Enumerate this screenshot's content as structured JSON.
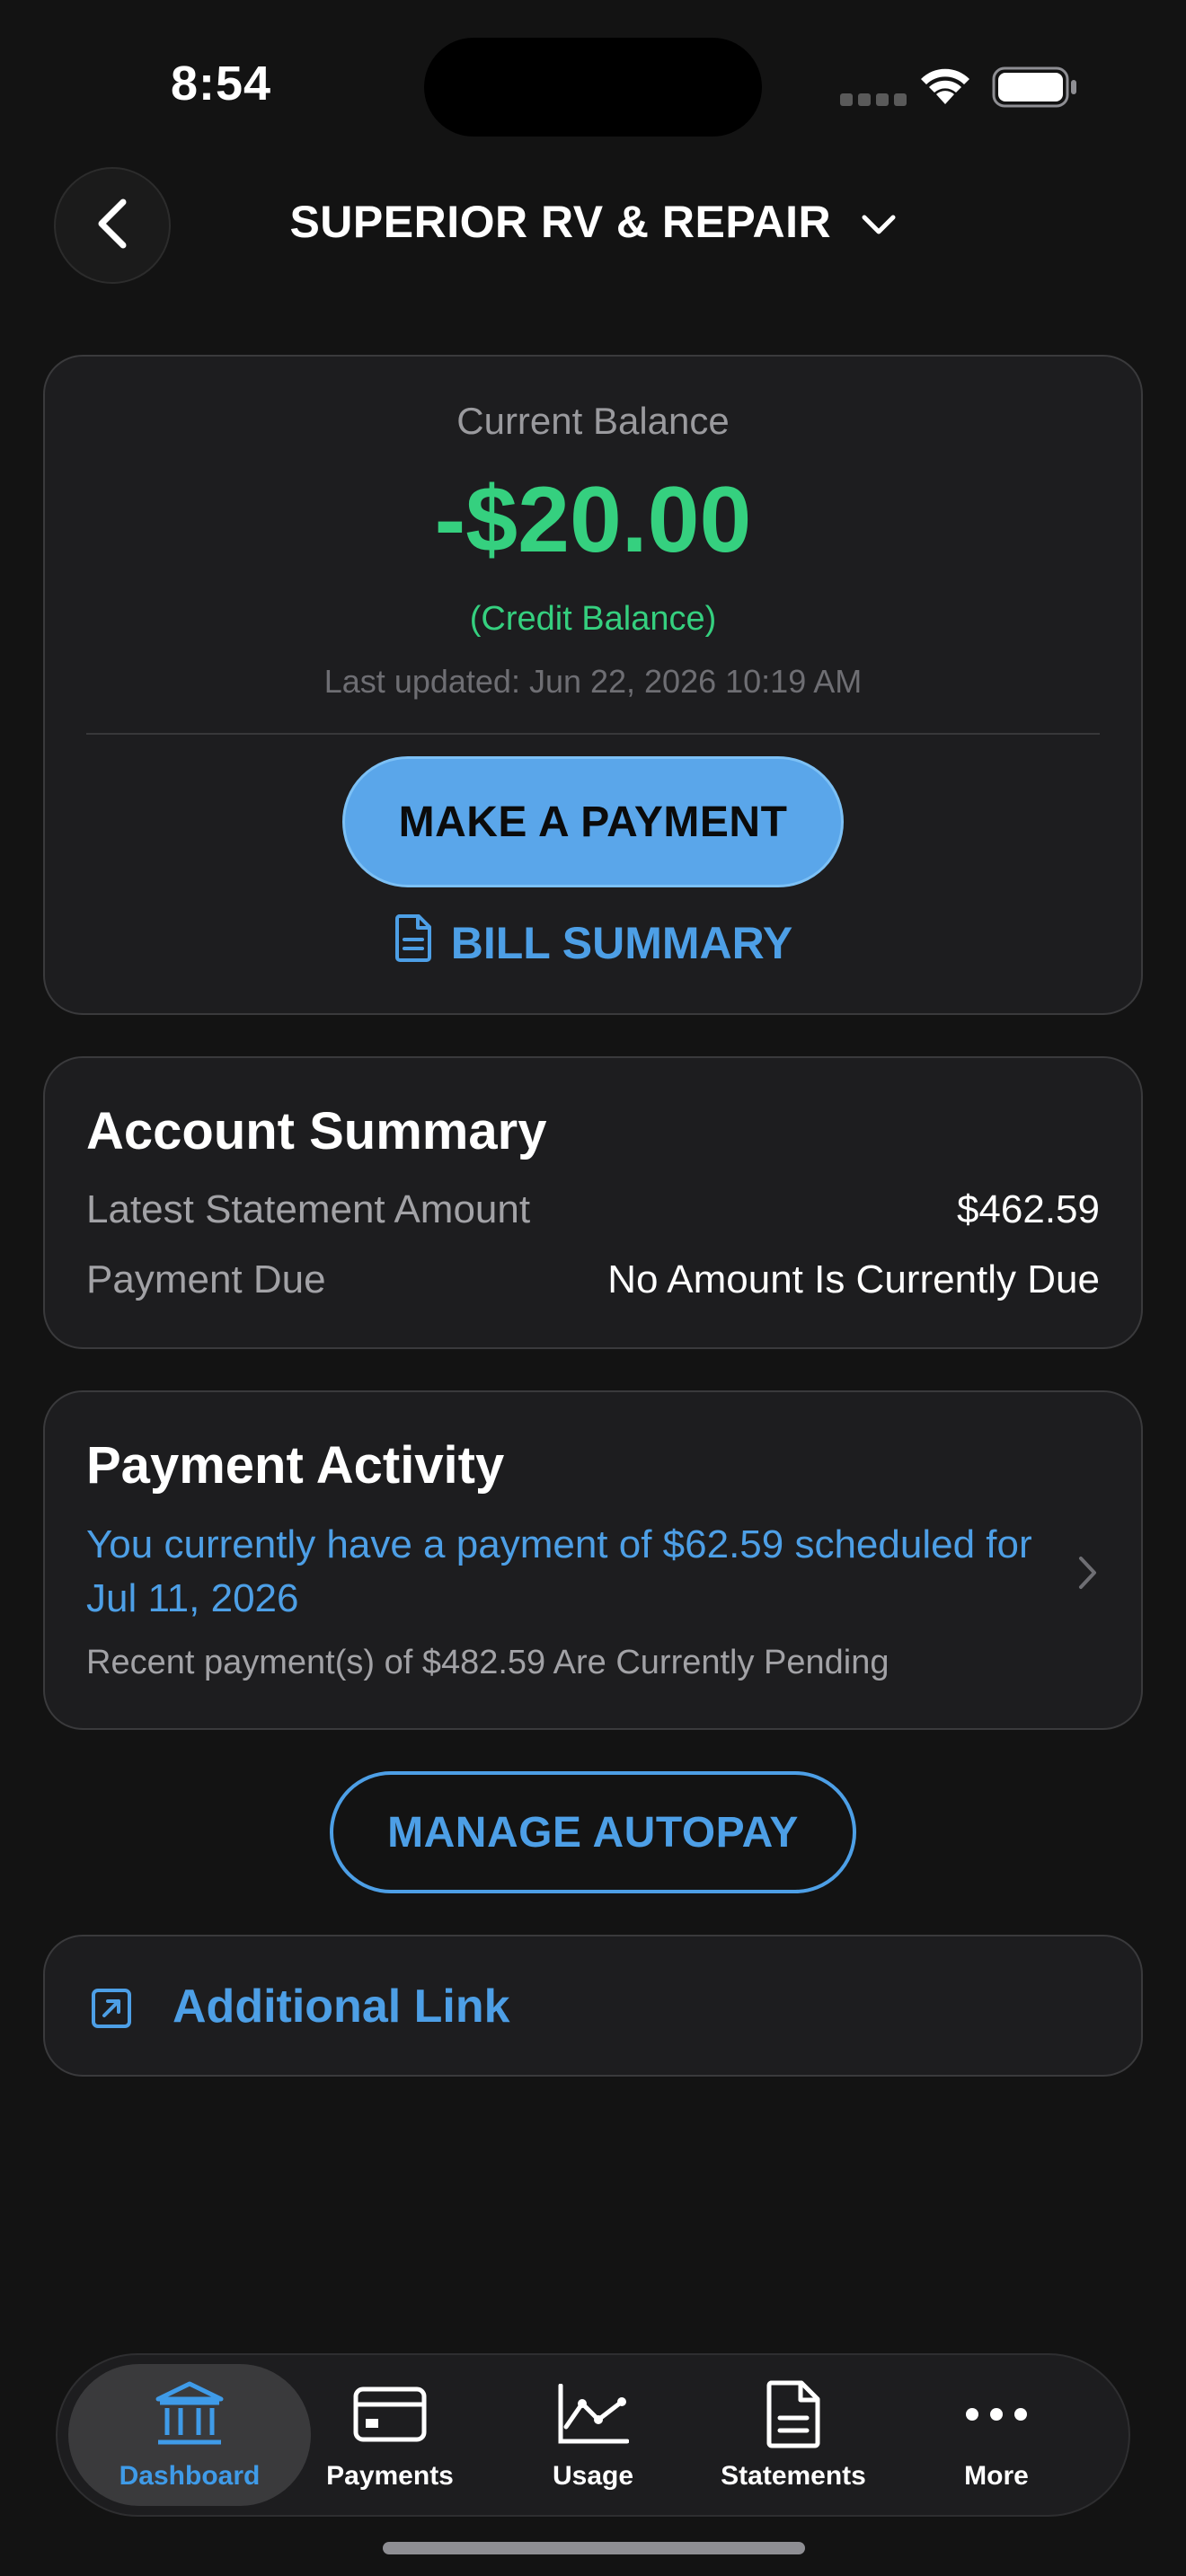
{
  "status_bar": {
    "time": "8:54"
  },
  "header": {
    "title": "SUPERIOR RV & REPAIR"
  },
  "balance": {
    "label": "Current Balance",
    "amount": "-$20.00",
    "note": "(Credit Balance)",
    "updated": "Last updated: Jun 22, 2026 10:19 AM",
    "pay_button": "MAKE A PAYMENT",
    "bill_summary": "BILL SUMMARY",
    "amount_color": "#35d07f"
  },
  "account_summary": {
    "title": "Account Summary",
    "rows": [
      {
        "label": "Latest Statement Amount",
        "value": "$462.59"
      },
      {
        "label": "Payment Due",
        "value": "No Amount Is Currently Due"
      }
    ]
  },
  "payment_activity": {
    "title": "Payment Activity",
    "message": "You currently have a payment of $62.59 scheduled for Jul 11, 2026",
    "pending": "Recent payment(s) of $482.59 Are Currently Pending"
  },
  "autopay": {
    "label": "MANAGE AUTOPAY"
  },
  "additional_link": {
    "label": "Additional Link"
  },
  "tabs": [
    {
      "label": "Dashboard",
      "icon": "bank-icon",
      "active": true
    },
    {
      "label": "Payments",
      "icon": "credit-card-icon",
      "active": false
    },
    {
      "label": "Usage",
      "icon": "line-chart-icon",
      "active": false
    },
    {
      "label": "Statements",
      "icon": "document-icon",
      "active": false
    },
    {
      "label": "More",
      "icon": "ellipsis-icon",
      "active": false
    }
  ],
  "colors": {
    "accent": "#4d9fe6",
    "button_fill": "#5aa6ea",
    "positive": "#35d07f",
    "background": "#131313",
    "card": "#1d1d1f"
  }
}
